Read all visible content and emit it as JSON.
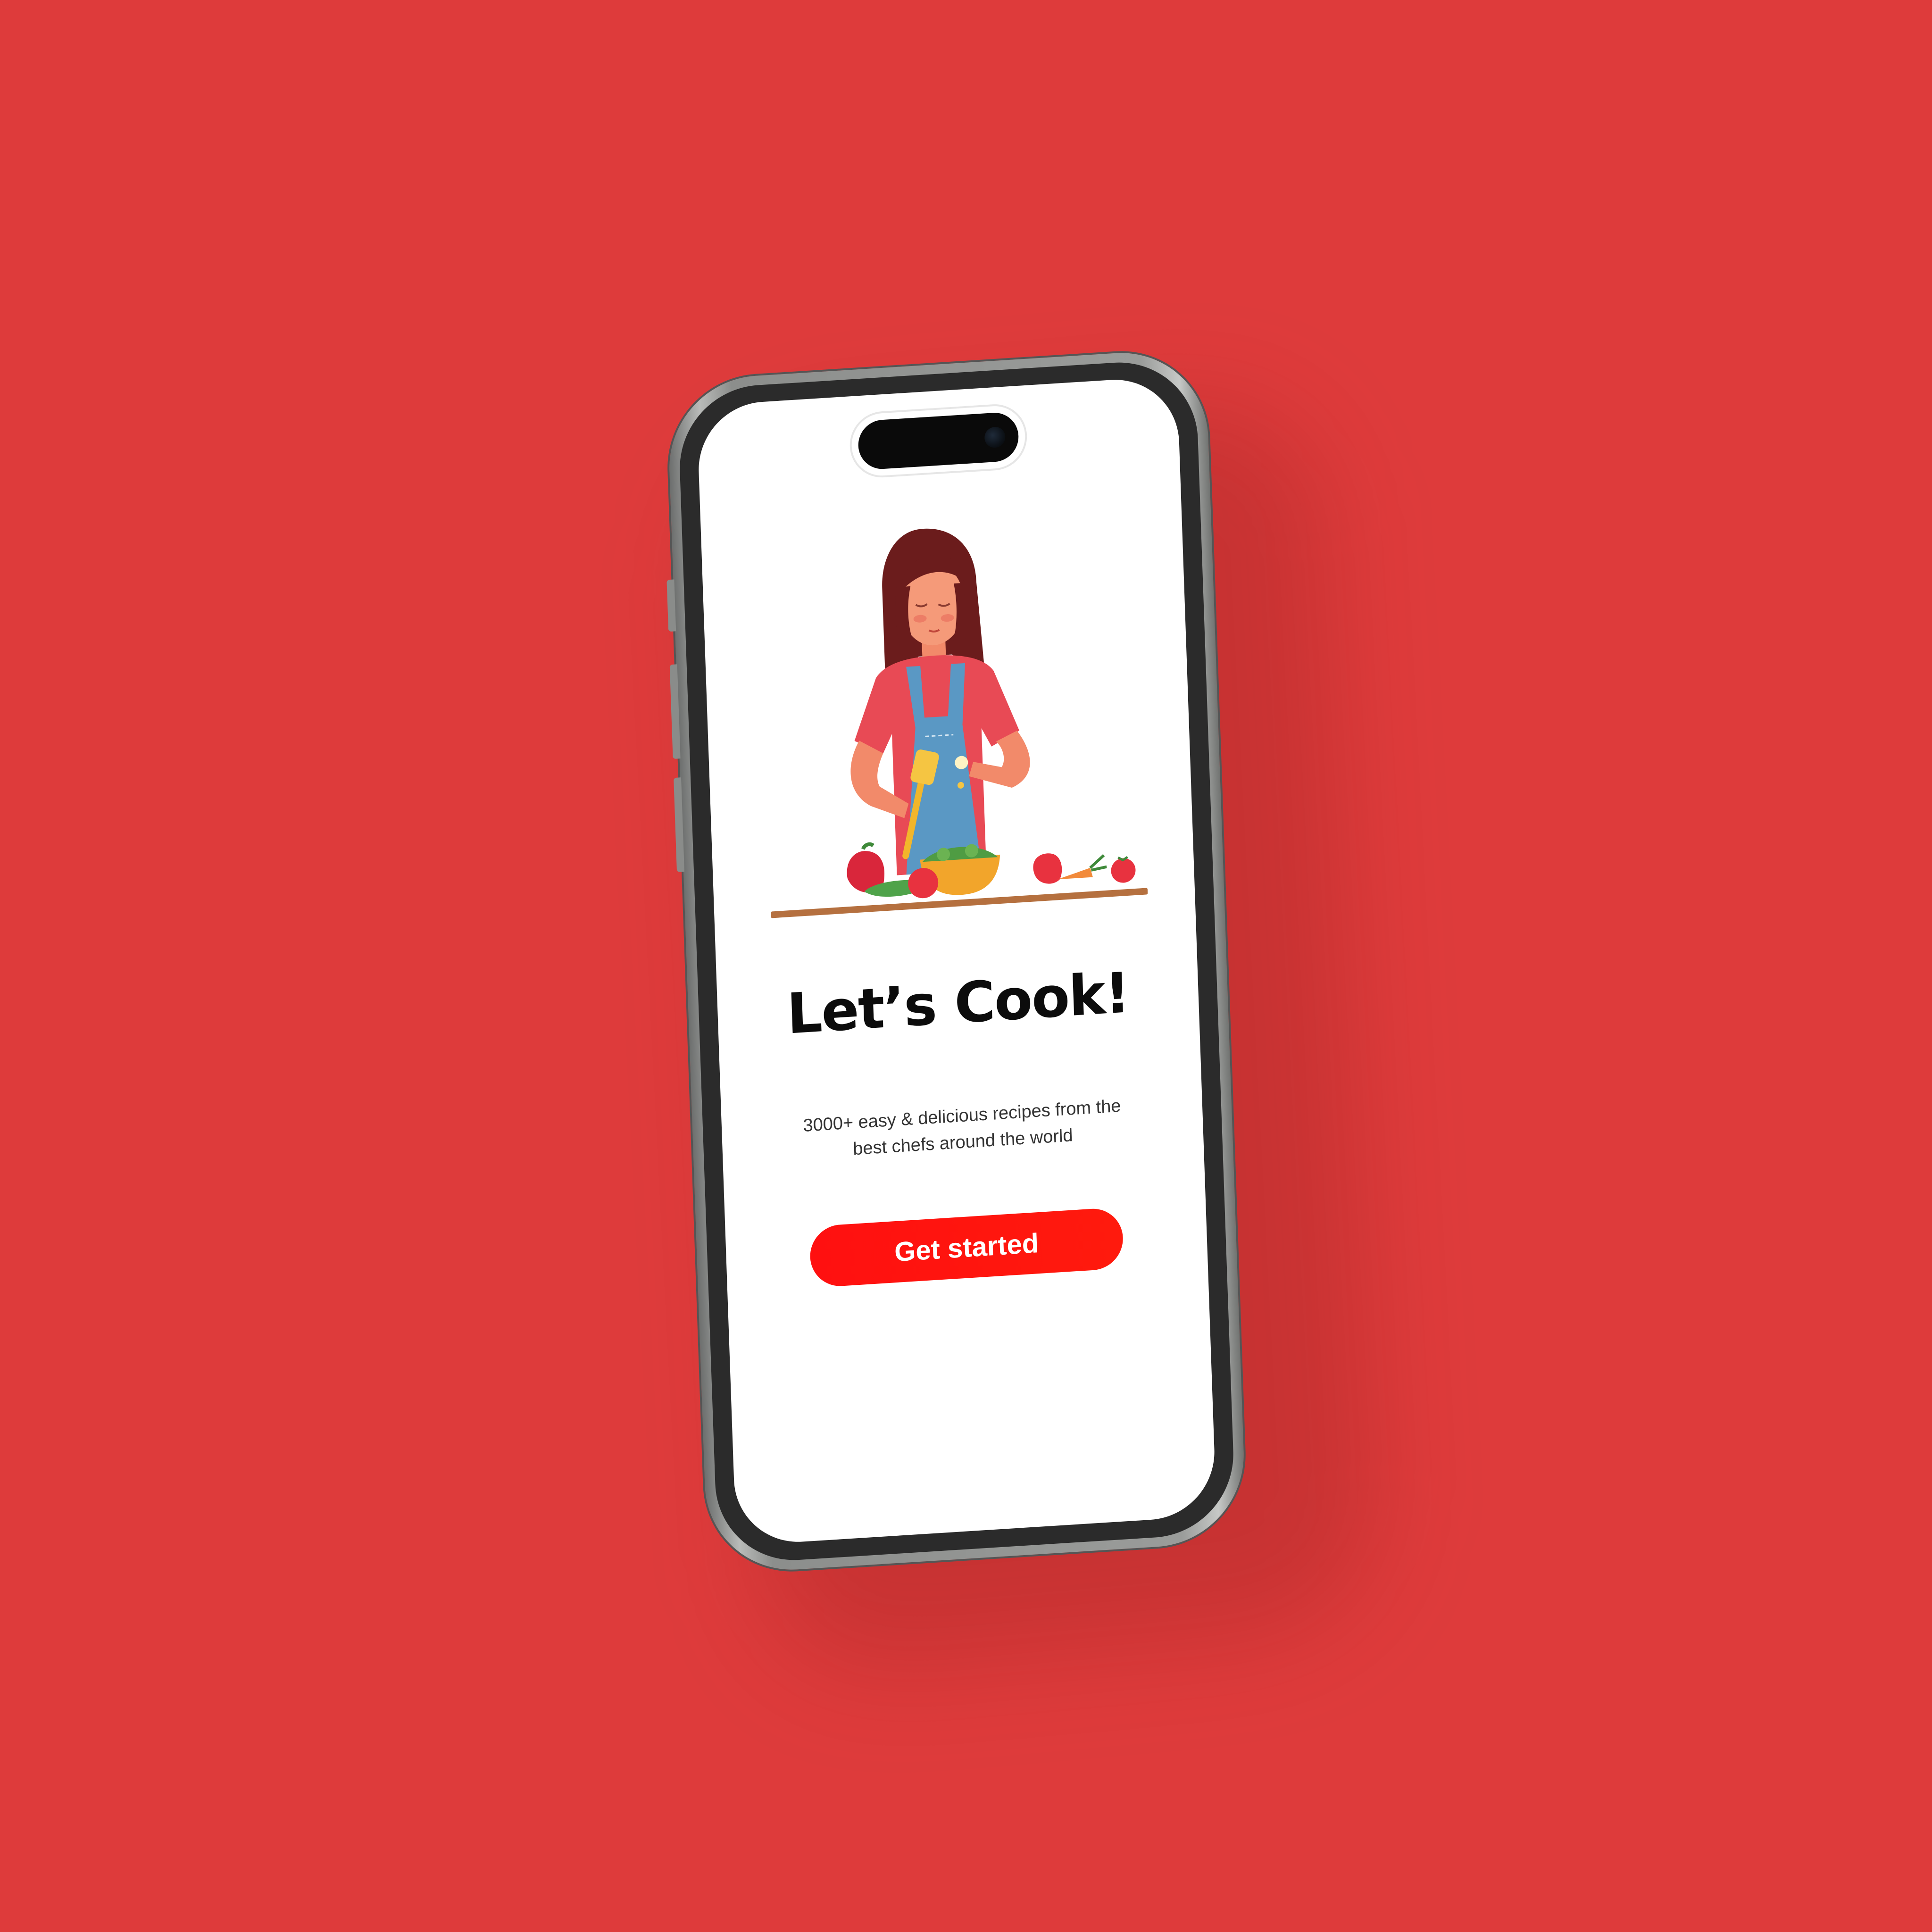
{
  "onboarding": {
    "title": "Let’s Cook!",
    "subtitle": "3000+ easy & delicious recipes from the best chefs around the world",
    "cta_label": "Get started"
  },
  "illustration": {
    "icon": "woman-cooking-salad-illustration"
  },
  "colors": {
    "background": "#de3b3b",
    "accent": "#ff1010",
    "screen": "#ffffff",
    "title_text": "#0c0c0c"
  }
}
